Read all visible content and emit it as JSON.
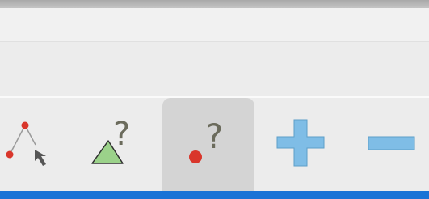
{
  "toolbar": {
    "tools": [
      {
        "name": "polygon-move-tool",
        "icon": "polygon-vertex-arrow-icon",
        "selected": false
      },
      {
        "name": "relation-triangle-tool",
        "icon": "triangle-question-icon",
        "glyph": "?",
        "selected": false
      },
      {
        "name": "relation-point-tool",
        "icon": "point-question-icon",
        "glyph": "?",
        "selected": true
      },
      {
        "name": "zoom-in-tool",
        "icon": "plus-icon",
        "selected": false
      },
      {
        "name": "zoom-out-tool",
        "icon": "minus-icon",
        "selected": false
      }
    ]
  },
  "colors": {
    "accent_bar": "#1a73d6",
    "point_red": "#d9362b",
    "triangle_green": "#9bd28a",
    "question_gray": "#6b6b5c",
    "zoom_blue": "#7fbde6"
  }
}
